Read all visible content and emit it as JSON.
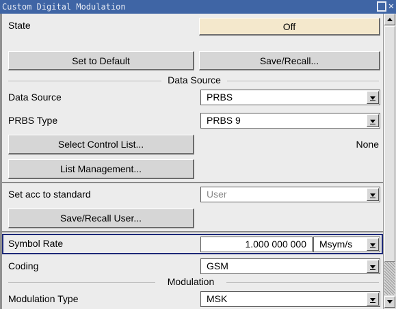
{
  "window": {
    "title": "Custom Digital Modulation"
  },
  "state": {
    "label": "State",
    "value": "Off"
  },
  "buttons": {
    "set_default": "Set to Default",
    "save_recall": "Save/Recall..."
  },
  "data_source_section": {
    "title": "Data Source",
    "data_source": {
      "label": "Data Source",
      "value": "PRBS"
    },
    "prbs_type": {
      "label": "PRBS Type",
      "value": "PRBS 9"
    },
    "select_control_list": "Select Control List...",
    "control_list_value": "None",
    "list_management": "List Management..."
  },
  "standard": {
    "label": "Set acc to standard",
    "value": "User",
    "save_recall_user": "Save/Recall User..."
  },
  "symbol_rate": {
    "label": "Symbol Rate",
    "value": "1.000 000 000",
    "unit": "Msym/s"
  },
  "coding": {
    "label": "Coding",
    "value": "GSM"
  },
  "modulation_section": {
    "title": "Modulation",
    "type": {
      "label": "Modulation Type",
      "value": "MSK"
    }
  },
  "colors": {
    "titlebar": "#3f65a5",
    "state_off_bg": "#f4e8cc",
    "focus_border": "#1c2878",
    "disabled_text": "#8a8a8a"
  }
}
